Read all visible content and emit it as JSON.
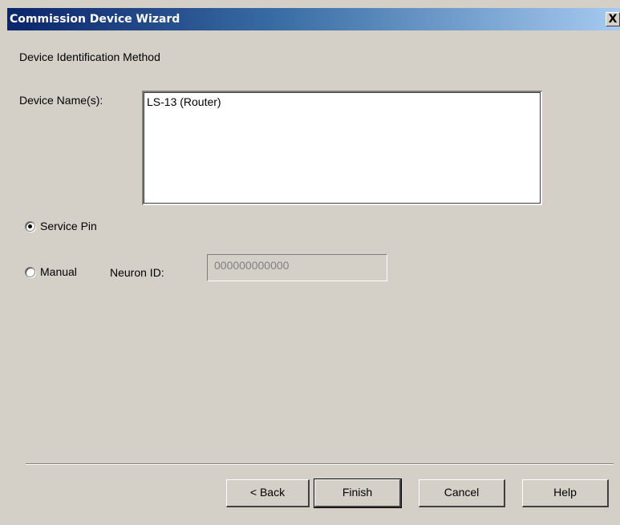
{
  "window": {
    "title": "Commission Device Wizard",
    "close_glyph": "X"
  },
  "section_title": "Device Identification Method",
  "device_names": {
    "label": "Device Name(s):",
    "items": [
      "LS-13 (Router)"
    ]
  },
  "method": {
    "service_pin_label": "Service Pin",
    "service_pin_selected": true,
    "manual_label": "Manual",
    "manual_selected": false,
    "neuron_id_label": "Neuron ID:",
    "neuron_id_value": "000000000000"
  },
  "buttons": {
    "back": "< Back",
    "finish": "Finish",
    "cancel": "Cancel",
    "help": "Help"
  },
  "colors": {
    "dialog_bg": "#d4d0c8",
    "title_start": "#0a246a",
    "title_end": "#a6caf0"
  }
}
